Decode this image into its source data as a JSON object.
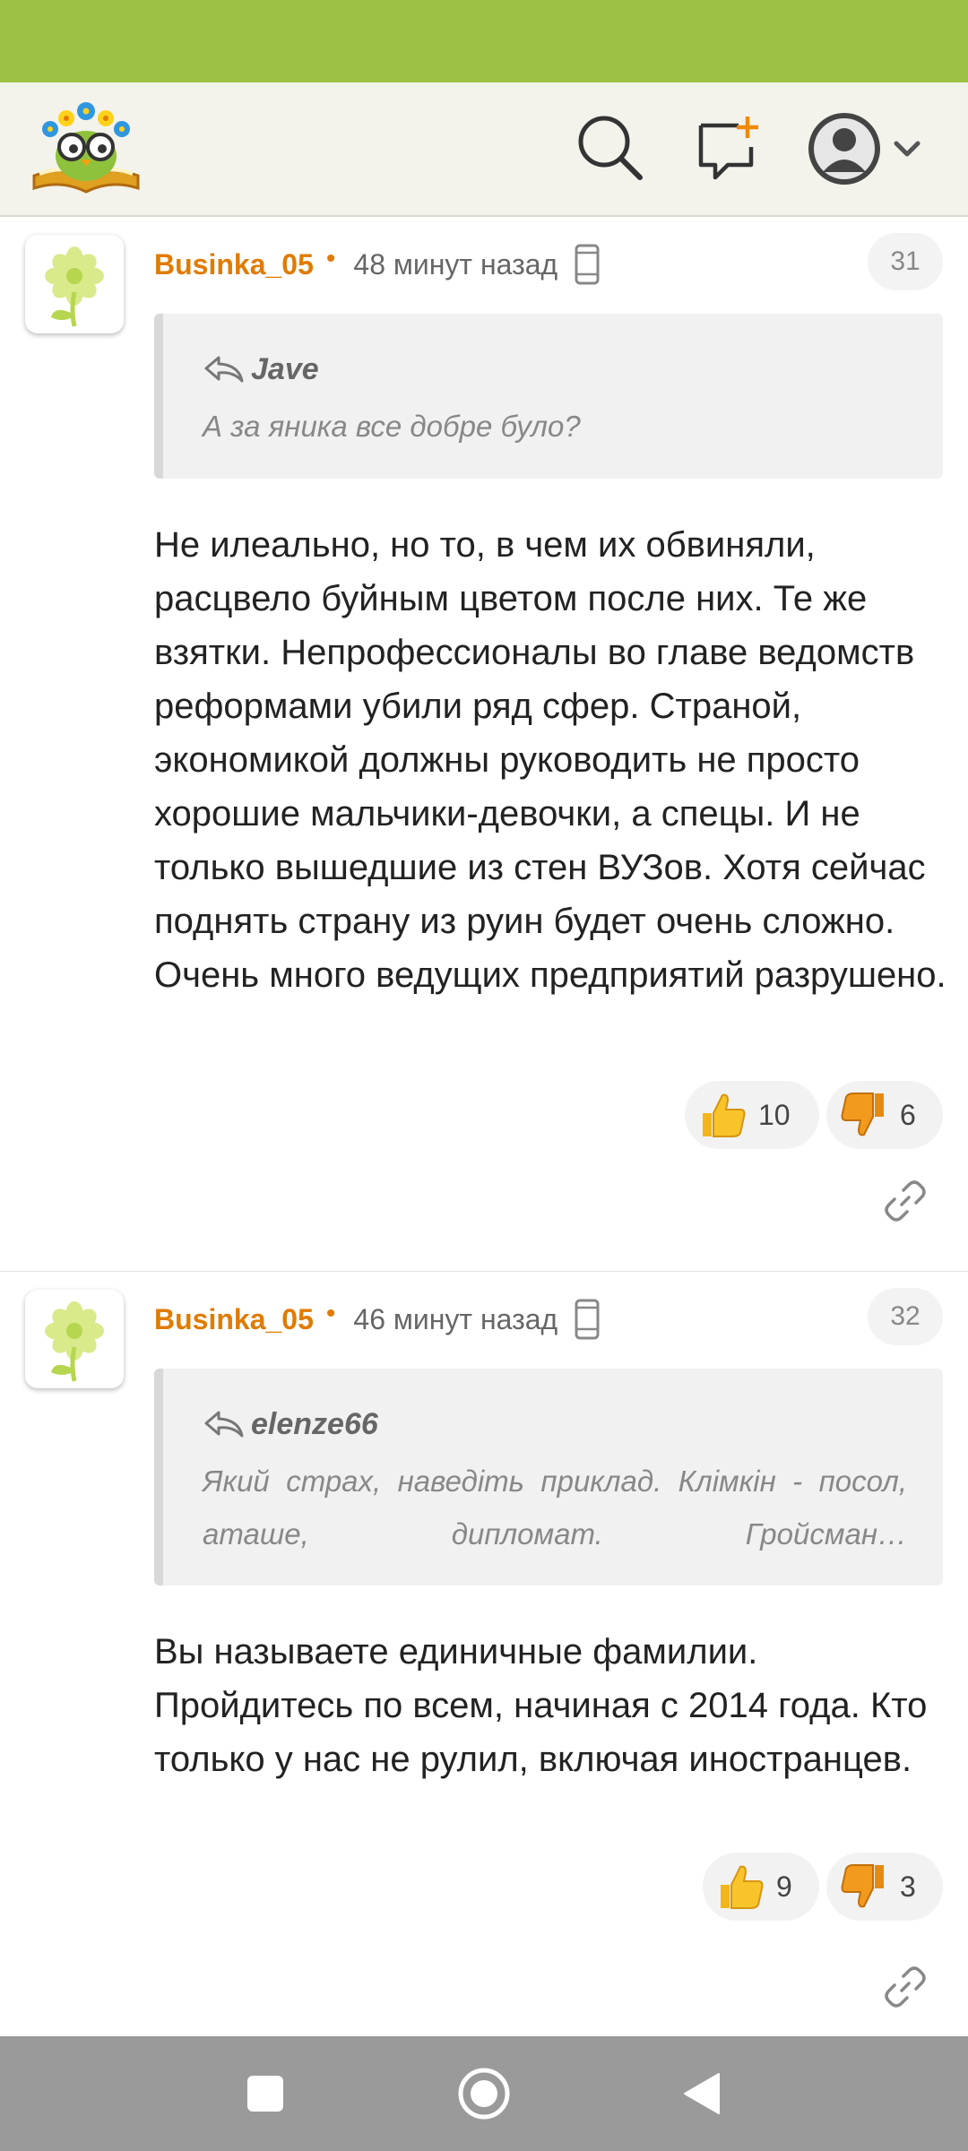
{
  "header": {
    "logo": "owl-on-book-logo",
    "icons": [
      "search-icon",
      "new-post-icon",
      "profile-avatar-icon",
      "chevron-down-icon"
    ]
  },
  "comments": [
    {
      "author": "Businka_05",
      "time": "48 минут назад",
      "number": "31",
      "quote_author": "Jave",
      "quote_text": "А за яника все добре було?",
      "text": "Не илеально, но то, в чем их обвиняли, расцвело буйным цветом после них. Те же взятки. Непрофессионалы во главе ведомств реформами убили ряд сфер. Страной, экономикой должны руководить не просто хорошие мальчики-девочки, а спецы. И не только вышедшие из стен ВУЗов. Хотя сейчас поднять страну из руин будет очень сложно. Очень много ведущих предприятий разрушено.",
      "likes": "10",
      "dislikes": "6"
    },
    {
      "author": "Businka_05",
      "time": "46 минут назад",
      "number": "32",
      "quote_author": "elenze66",
      "quote_text": "Який страх, наведіть приклад. Клімкін - посол, аташе, дипломат. Гройсман…",
      "text": "Вы называете единичные фамилии. Пройдитесь по всем, начиная с 2014 года. Кто только у нас не рулил, включая иностранцев.",
      "likes": "9",
      "dislikes": "3"
    }
  ],
  "colors": {
    "status_bar": "#9dc143",
    "header_bg": "#f3f3ec",
    "author": "#e07b00",
    "nav_bar": "#9a9a9a"
  }
}
